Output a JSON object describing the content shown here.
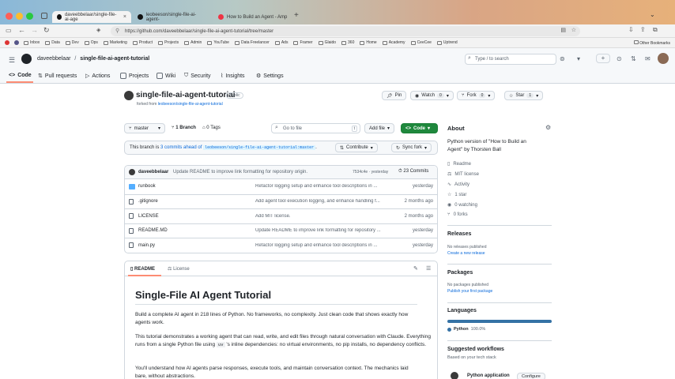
{
  "browser": {
    "tabs": [
      {
        "label": "daveebbelaar/single-file-ai-age"
      },
      {
        "label": "leobeeson/single-file-ai-agent-"
      },
      {
        "label": "How to Build an Agent - Amp"
      }
    ],
    "url": "https://github.com/daveebbelaar/single-file-ai-agent-tutorial/tree/master",
    "bookmarks": [
      "Inbox",
      "Data",
      "Dev",
      "Ops",
      "Marketing",
      "Product",
      "Projects",
      "Admin",
      "YouTube",
      "Data Freelancer",
      "Ads",
      "Framer",
      "Glaido",
      "360",
      "Home",
      "Academy",
      "CeeCee",
      "Uptrend"
    ],
    "other_bookmarks": "Other Bookmarks"
  },
  "header": {
    "owner": "daveebbelaar",
    "separator": "/",
    "repo": "single-file-ai-agent-tutorial",
    "search_placeholder": "Type / to search",
    "nav": [
      "Code",
      "Pull requests",
      "Actions",
      "Projects",
      "Wiki",
      "Security",
      "Insights",
      "Settings"
    ]
  },
  "repo": {
    "title": "single-file-ai-agent-tutorial",
    "visibility": "Public",
    "forked_from_prefix": "forked from",
    "forked_from": "leobeeson/single-file-ai-agent-tutorial",
    "pin": "Pin",
    "watch": "Watch",
    "watch_count": "0",
    "fork": "Fork",
    "fork_count": "0",
    "star": "Star",
    "star_count": "1"
  },
  "branchbar": {
    "branch": "master",
    "branches": "1 Branch",
    "tags": "0 Tags",
    "goto_placeholder": "Go to file",
    "goto_key": "t",
    "add_file": "Add file",
    "code": "Code"
  },
  "ahead": {
    "prefix": "This branch is",
    "link": "3 commits ahead of",
    "ref": "leobeeson/single-file-ai-agent-tutorial:master",
    "suffix": ".",
    "contribute": "Contribute",
    "sync": "Sync fork"
  },
  "commit": {
    "author": "daveebbelaar",
    "message": "Update README to improve link formatting for repository origin.",
    "hash": "7534c4e · yesterday",
    "count": "23 Commits"
  },
  "files": [
    {
      "name": "runbook",
      "type": "folder",
      "message": "Refactor logging setup and enhance tool descriptions in ...",
      "date": "yesterday"
    },
    {
      "name": ".gitignore",
      "type": "file",
      "message": "Add agent tool execution logging, and enhance handling f...",
      "date": "2 months ago"
    },
    {
      "name": "LICENSE",
      "type": "file",
      "message": "Add MIT license.",
      "date": "2 months ago"
    },
    {
      "name": "README.MD",
      "type": "file",
      "message": "Update README to improve link formatting for repository ...",
      "date": "yesterday"
    },
    {
      "name": "main.py",
      "type": "file",
      "message": "Refactor logging setup and enhance tool descriptions in ...",
      "date": "yesterday"
    }
  ],
  "readme": {
    "tab1": "README",
    "tab2": "License",
    "title": "Single-File AI Agent Tutorial",
    "p1": "Build a complete AI agent in 218 lines of Python. No frameworks, no complexity. Just clean code that shows exactly how agents work.",
    "p2a": "This tutorial demonstrates a working agent that can read, write, and edit files through natural conversation with Claude. Everything runs from a single Python file using ",
    "p2code": "uv",
    "p2b": " 's inline dependencies: no virtual environments, no pip installs, no dependency conflicts.",
    "p3": "You'll understand how AI agents parse responses, execute tools, and maintain conversation context. The mechanics laid bare, without abstractions."
  },
  "about": {
    "heading": "About",
    "description": "Python version of \"How to Build an Agent\" by Thorsten Ball",
    "items": [
      "Readme",
      "MIT license",
      "Activity",
      "1 star",
      "0 watching",
      "0 forks"
    ],
    "releases_heading": "Releases",
    "releases_text": "No releases published",
    "releases_link": "Create a new release",
    "packages_heading": "Packages",
    "packages_text": "No packages published",
    "packages_link": "Publish your first package",
    "languages_heading": "Languages",
    "language": "Python",
    "language_pct": "100.0%",
    "language_color": "#3572A5",
    "workflows_heading": "Suggested workflows",
    "workflows_sub": "Based on your tech stack",
    "workflow_name": "Python application",
    "workflow_btn": "Configure"
  },
  "colors": {
    "accent": "#0969da",
    "code_btn": "#1f883d",
    "underline": "#fd8c73"
  }
}
